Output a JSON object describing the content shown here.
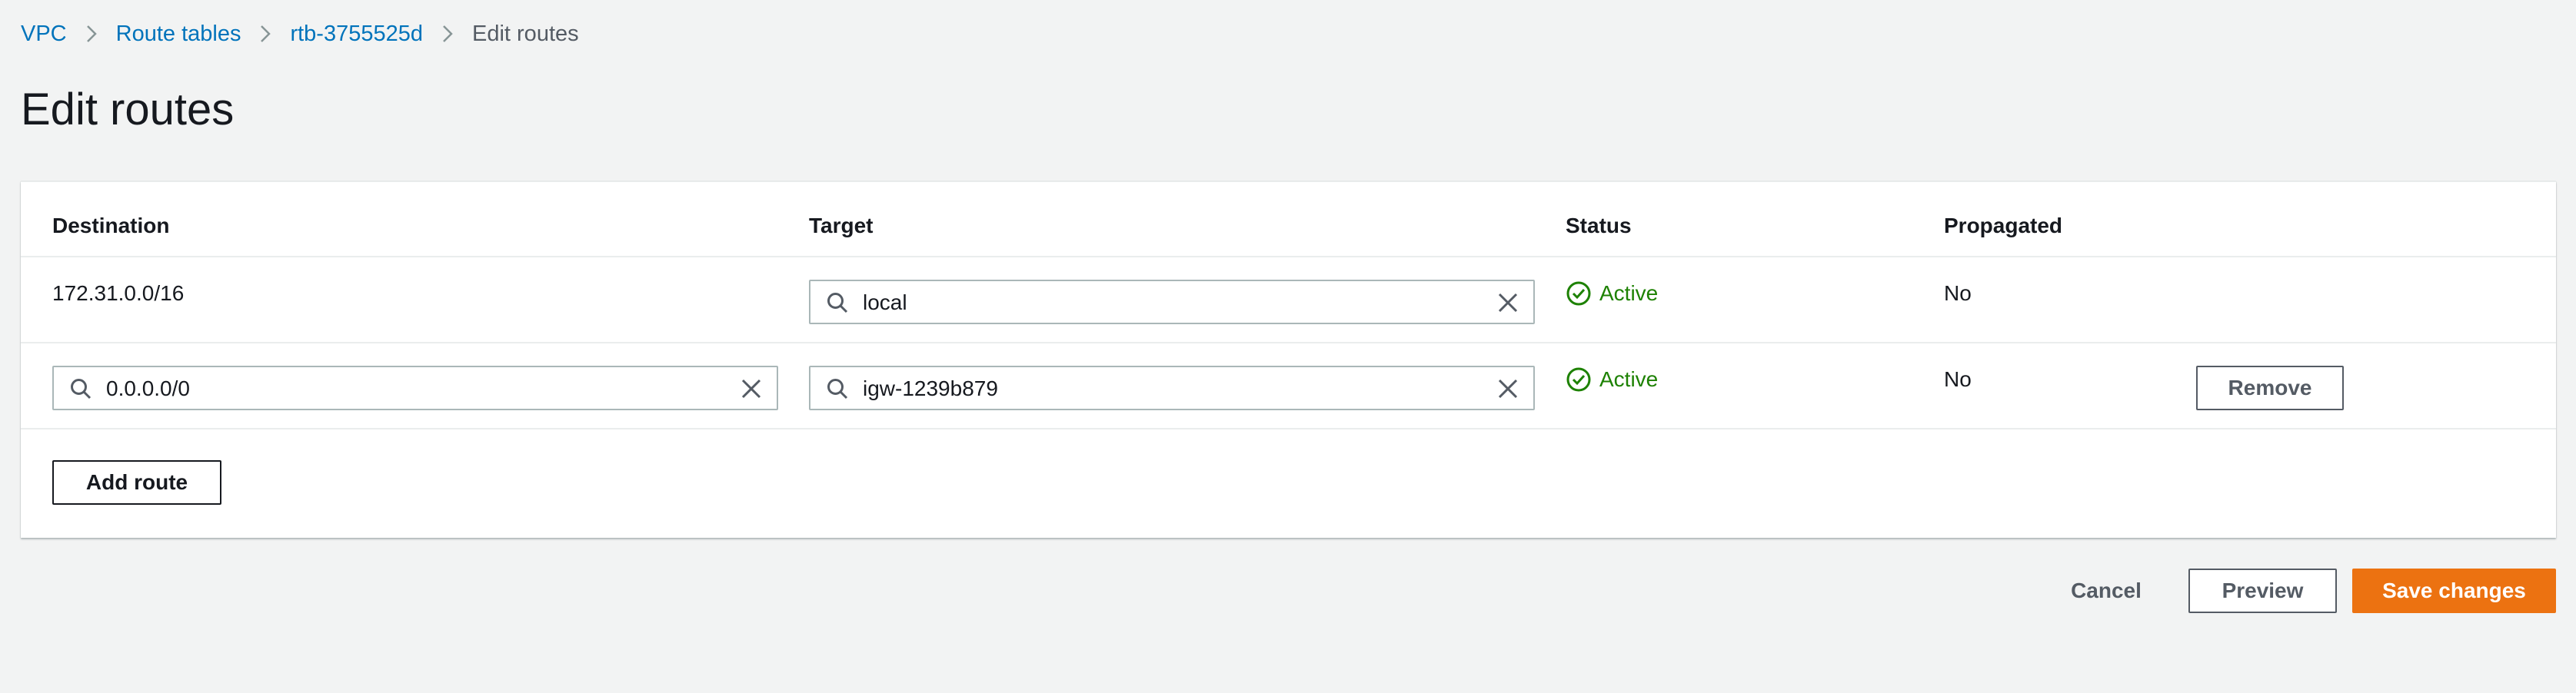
{
  "breadcrumb": {
    "items": [
      "VPC",
      "Route tables",
      "rtb-3755525d"
    ],
    "current": "Edit routes"
  },
  "page": {
    "title": "Edit routes"
  },
  "table": {
    "columns": [
      "Destination",
      "Target",
      "Status",
      "Propagated"
    ],
    "rows": [
      {
        "destination": "172.31.0.0/16",
        "target": "local",
        "status": "Active",
        "propagated": "No"
      },
      {
        "destination": "0.0.0.0/0",
        "target": "igw-1239b879",
        "status": "Active",
        "propagated": "No",
        "remove_label": "Remove"
      }
    ]
  },
  "add_route_label": "Add route",
  "footer": {
    "cancel_label": "Cancel",
    "preview_label": "Preview",
    "save_label": "Save changes"
  },
  "colors": {
    "link": "#0073bb",
    "status_active": "#1d8102",
    "primary_button": "#ec7211",
    "background": "#f2f3f3"
  },
  "icons": {
    "breadcrumb_separator": "chevron-right-icon",
    "input_search": "search-icon",
    "input_clear": "close-icon",
    "status": "check-circle-icon"
  }
}
